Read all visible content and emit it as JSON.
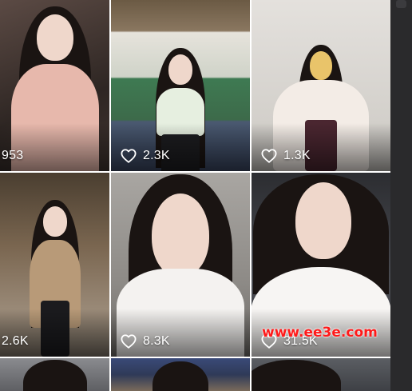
{
  "feed": {
    "tiles": [
      {
        "likes": "953",
        "bg": "#3a3330",
        "shirt": "#e7b8ac"
      },
      {
        "likes": "2.3K",
        "bg": "#3d5d48",
        "shirt": "#e6efe0"
      },
      {
        "likes": "1.3K",
        "bg": "#d9d6d2",
        "shirt": "#f3ece6"
      },
      {
        "likes": "2.6K",
        "bg": "#6b5c4a",
        "shirt": "#b89a78"
      },
      {
        "likes": "8.3K",
        "bg": "#8d8a86",
        "shirt": "#f4f2f0"
      },
      {
        "likes": "31.5K",
        "bg": "#3e3f44",
        "shirt": "#f7f5f3"
      },
      {
        "likes": "",
        "bg": "#6e6f73",
        "shirt": "#d8d4cf"
      },
      {
        "likes": "",
        "bg": "#2f3a58",
        "shirt": "#d8d4cf"
      },
      {
        "likes": "",
        "bg": "#4a4d52",
        "shirt": "#d8d4cf"
      }
    ],
    "like_icon": "heart-outline-icon"
  },
  "watermark": {
    "text": "www.ee3e.com",
    "color": "#ff1a1a"
  },
  "scrollbar": {
    "color": "#2a2a2c"
  }
}
